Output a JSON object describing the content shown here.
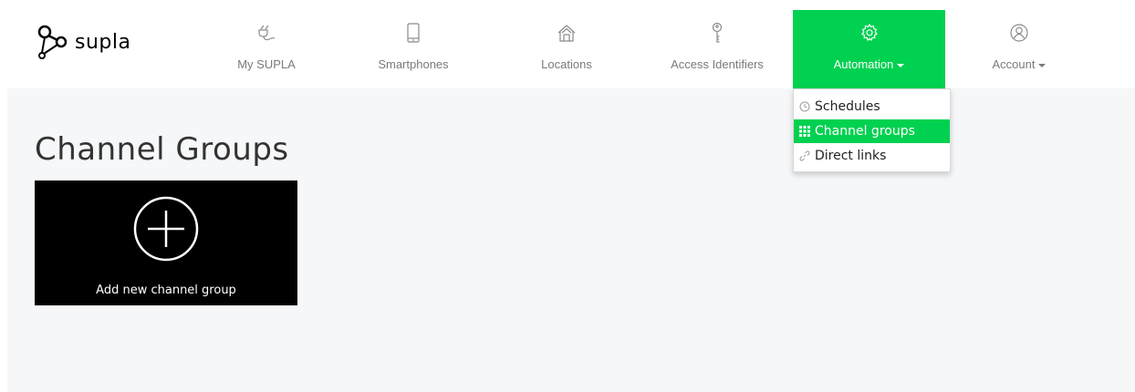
{
  "brand": {
    "name": "supla",
    "logo_icon": "supla-logo-icon"
  },
  "colors": {
    "accent": "#00d150",
    "tile_bg": "#000000",
    "content_bg": "#f6f7f9",
    "nav_text": "#7a7a7a"
  },
  "nav": {
    "my_supla": {
      "label": "My SUPLA",
      "icon": "plug-icon"
    },
    "smartphones": {
      "label": "Smartphones",
      "icon": "smartphone-icon"
    },
    "locations": {
      "label": "Locations",
      "icon": "house-icon"
    },
    "access_ids": {
      "label": "Access Identifiers",
      "icon": "key-icon"
    },
    "automation": {
      "label": "Automation",
      "icon": "gear-icon",
      "active": true
    },
    "account": {
      "label": "Account",
      "icon": "user-icon"
    }
  },
  "dropdown": {
    "items": [
      {
        "label": "Schedules",
        "icon": "clock-icon"
      },
      {
        "label": "Channel groups",
        "icon": "grid-icon",
        "active": true
      },
      {
        "label": "Direct links",
        "icon": "link-icon"
      }
    ]
  },
  "main": {
    "title": "Channel Groups",
    "add_tile": {
      "label": "Add new channel group",
      "icon": "plus-circle-icon"
    }
  }
}
